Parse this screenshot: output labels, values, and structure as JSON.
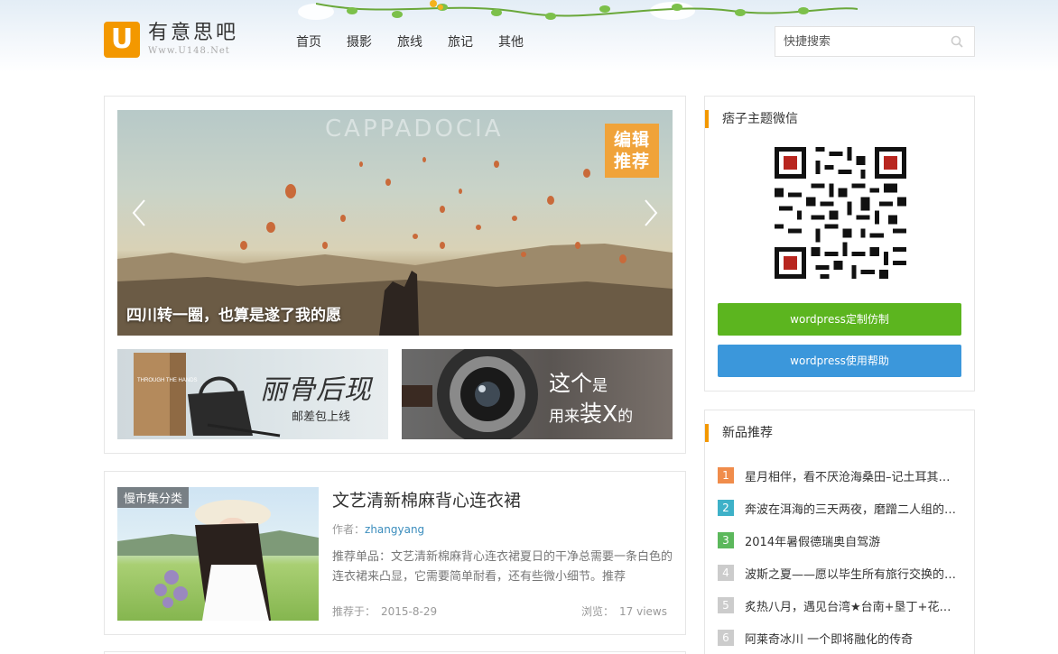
{
  "header": {
    "logo_letter": "U",
    "site_name": "有意思吧",
    "site_url": "Www.U148.Net",
    "nav": [
      "首页",
      "摄影",
      "旅线",
      "旅记",
      "其他"
    ],
    "search_placeholder": "快捷搜索",
    "search_icon": "search-icon"
  },
  "slider": {
    "watermark": "CAPPADOCIA",
    "badge": [
      "编辑",
      "推荐"
    ],
    "caption": "四川转一圈，也算是遂了我的愿",
    "prev_icon": "chevron-left-icon",
    "next_icon": "chevron-right-icon",
    "thumb1": {
      "title": "丽骨后现",
      "subtitle": "邮差包上线",
      "box_text": "THROUGH THE HANDS"
    },
    "thumb2": {
      "line1_main": "这个",
      "line1_small": "是",
      "line2_a": "用来",
      "line2_b": "装X",
      "line2_c": "的"
    }
  },
  "post": {
    "category": "慢市集分类",
    "title": "文艺清新棉麻背心连衣裙",
    "author_label": "作者：",
    "author": "zhangyang",
    "excerpt": "推荐单品：文艺清新棉麻背心连衣裙夏日的干净总需要一条白色的连衣裙来凸显，它需要简单耐看，还有些微小细节。推荐",
    "date_label": "推荐于：",
    "date": "2015-8-29",
    "views_label": "浏览：",
    "views": "17 views"
  },
  "sidebar": {
    "wechat_title": "痞子主题微信",
    "btn_custom": "wordpress定制仿制",
    "btn_help": "wordpress使用帮助",
    "new_title": "新品推荐",
    "new_items": [
      {
        "num": "1",
        "text": "星月相伴，看不厌沧海桑田–记土耳其…",
        "color": "#f08c4b"
      },
      {
        "num": "2",
        "text": "奔波在洱海的三天两夜，磨蹭二人组的…",
        "color": "#3eb1c8"
      },
      {
        "num": "3",
        "text": "2014年暑假德瑞奥自驾游",
        "color": "#5cb85c"
      },
      {
        "num": "4",
        "text": "波斯之夏——愿以毕生所有旅行交换的…",
        "color": "#cccccc"
      },
      {
        "num": "5",
        "text": "炙热八月，遇见台湾★台南+垦丁+花东…",
        "color": "#cccccc"
      },
      {
        "num": "6",
        "text": "阿莱奇冰川 一个即将融化的传奇",
        "color": "#cccccc"
      }
    ]
  },
  "colors": {
    "accent": "#f39800",
    "green_button": "#5cb51f",
    "blue_button": "#3b97db",
    "link": "#3b8dbd"
  }
}
